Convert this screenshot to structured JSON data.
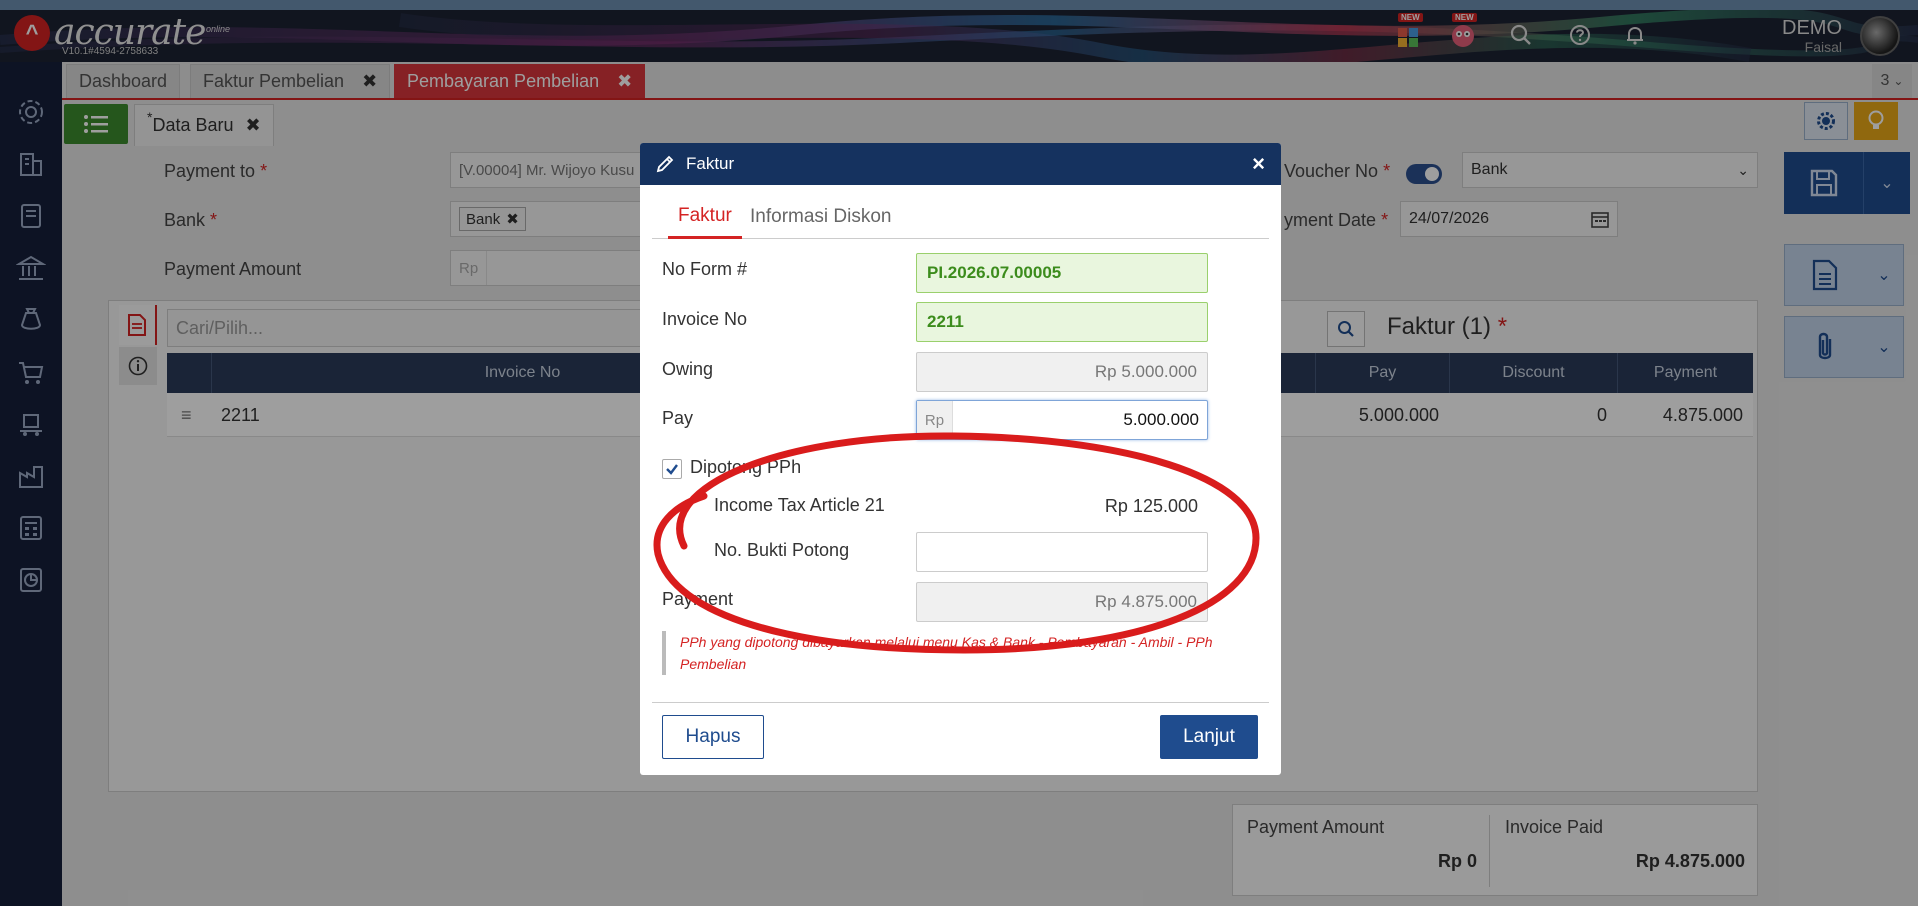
{
  "app": {
    "logo_text": "accurate",
    "logo_sub": "online",
    "version": "V10.1#4594-2758633",
    "company": "DEMO",
    "user": "Faisal",
    "new_badge": "NEW"
  },
  "tabs": [
    {
      "label": "Dashboard"
    },
    {
      "label": "Faktur Pembelian"
    },
    {
      "label": "Pembayaran Pembelian"
    }
  ],
  "tab_count": "3",
  "doc_tab": {
    "label": "Data Baru",
    "marker": "*"
  },
  "form": {
    "payment_to_label": "Payment to",
    "payment_to_value": "[V.00004] Mr. Wijoyo Kusu",
    "bank_label": "Bank",
    "bank_chip": "Bank",
    "payment_amount_label": "Payment Amount",
    "payment_amount_prefix": "Rp",
    "voucher_label": "Voucher No",
    "voucher_select": "Bank",
    "payment_date_label": "yment Date",
    "payment_date_value": "24/07/2026",
    "required_mark": "*"
  },
  "panel": {
    "search_placeholder": "Cari/Pilih...",
    "title": "Faktur (1)",
    "title_mark": "*",
    "columns": {
      "invoice_no": "Invoice No",
      "pay": "Pay",
      "discount": "Discount",
      "payment": "Payment"
    },
    "rows": [
      {
        "invoice_no": "2211",
        "pay": "5.000.000",
        "discount": "0",
        "payment": "4.875.000"
      }
    ]
  },
  "totals": {
    "payment_amount_label": "Payment Amount",
    "payment_amount_value": "Rp 0",
    "invoice_paid_label": "Invoice Paid",
    "invoice_paid_value": "Rp 4.875.000"
  },
  "modal": {
    "title": "Faktur",
    "tabs": [
      {
        "label": "Faktur"
      },
      {
        "label": "Informasi Diskon"
      }
    ],
    "no_form_label": "No Form #",
    "no_form_value": "PI.2026.07.00005",
    "invoice_no_label": "Invoice No",
    "invoice_no_value": "2211",
    "owing_label": "Owing",
    "owing_value": "Rp 5.000.000",
    "pay_label": "Pay",
    "pay_prefix": "Rp",
    "pay_value": "5.000.000",
    "dipotong_label": "Dipotong PPh",
    "income_tax_label": "Income Tax Article 21",
    "income_tax_value": "Rp 125.000",
    "bukti_potong_label": "No. Bukti Potong",
    "bukti_potong_value": "",
    "payment_label": "Payment",
    "payment_value": "Rp 4.875.000",
    "note": "PPh yang dipotong dibayarkan melalui menu Kas & Bank - Pembayaran - Ambil - PPh Pembelian",
    "hapus_label": "Hapus",
    "lanjut_label": "Lanjut"
  },
  "colors": {
    "brand_red": "#d42323",
    "navy": "#15325f",
    "button_blue": "#1f4c8e",
    "annotation_red": "#d91c1c"
  }
}
